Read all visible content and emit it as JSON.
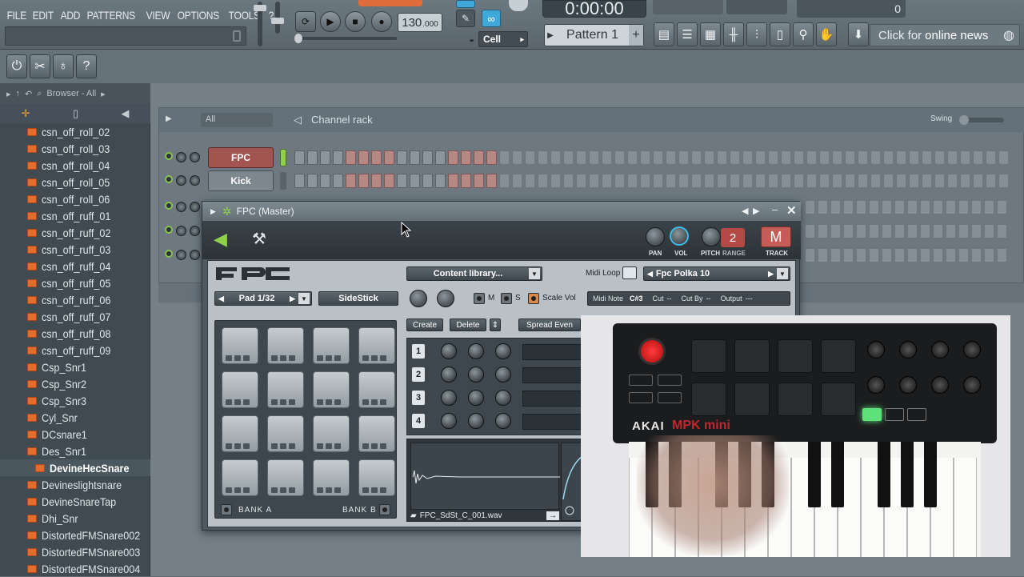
{
  "menu": [
    "FILE",
    "EDIT",
    "ADD",
    "PATTERNS",
    "VIEW",
    "OPTIONS",
    "TOOLS",
    "?"
  ],
  "transport": {
    "tempo": "130",
    "tempo_decimal": ".000",
    "time": "0:00:00",
    "cell_mode": "Cell",
    "pattern": "Pattern 1",
    "pattern_add": "+",
    "volume_readout": "0"
  },
  "news": {
    "prefix": "Click for",
    "highlight": "online news"
  },
  "browser": {
    "header": "Browser - All",
    "items": [
      "csn_off_roll_02",
      "csn_off_roll_03",
      "csn_off_roll_04",
      "csn_off_roll_05",
      "csn_off_roll_06",
      "csn_off_ruff_01",
      "csn_off_ruff_02",
      "csn_off_ruff_03",
      "csn_off_ruff_04",
      "csn_off_ruff_05",
      "csn_off_ruff_06",
      "csn_off_ruff_07",
      "csn_off_ruff_08",
      "csn_off_ruff_09",
      "Csp_Snr1",
      "Csp_Snr2",
      "Csp_Snr3",
      "Cyl_Snr",
      "DCsnare1",
      "Des_Snr1",
      "DevineHecSnare",
      "Devineslightsnare",
      "DevineSnareTap",
      "Dhi_Snr",
      "DistortedFMSnare002",
      "DistortedFMSnare003",
      "DistortedFMSnare004"
    ],
    "selected_index": 20
  },
  "rack": {
    "filter": "All",
    "title": "Channel rack",
    "swing_label": "Swing",
    "channels": [
      {
        "name": "FPC",
        "pattern": [
          1,
          1,
          1,
          1,
          1,
          1,
          1,
          1,
          1,
          1,
          1,
          1,
          1,
          1,
          1,
          1
        ]
      },
      {
        "name": "Kick",
        "pattern": [
          1,
          1,
          1,
          1,
          1,
          1,
          1,
          1,
          1,
          1,
          1,
          1,
          1,
          1,
          1,
          1
        ]
      }
    ]
  },
  "fpc": {
    "title": "FPC (Master)",
    "knob_labels": {
      "pan": "PAN",
      "vol": "VOL",
      "pitch": "PITCH",
      "range": "RANGE",
      "track": "TRACK"
    },
    "range_value": "2",
    "track_value": "M",
    "content_library": "Content library...",
    "midi_loop_label": "Midi Loop",
    "midi_loop_value": "Fpc Polka 10",
    "pad_selector": "Pad 1/32",
    "pad_name": "SideStick",
    "mute": "M",
    "solo": "S",
    "scale_vol": "Scale Vol",
    "midi_note_label": "Midi Note",
    "midi_note_value": "C#3",
    "cut_label": "Cut",
    "cut_value": "--",
    "cut_by_label": "Cut By",
    "cut_by_value": "--",
    "output_label": "Output",
    "output_value": "---",
    "buttons": {
      "create": "Create",
      "delete": "Delete",
      "spread": "Spread Even"
    },
    "layers": [
      "1",
      "2",
      "3",
      "4"
    ],
    "bank_a": "BANK A",
    "bank_b": "BANK B",
    "sample_file": "FPC_SdSt_C_001.wav"
  },
  "overlay": {
    "brand": "AKAI",
    "model": "MPK mini"
  }
}
